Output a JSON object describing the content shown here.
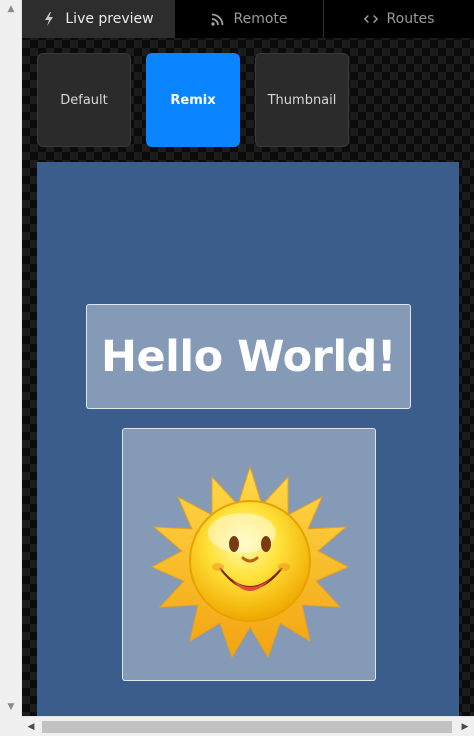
{
  "tabs": [
    {
      "label": "Live preview",
      "icon": "lightning-icon",
      "active": true
    },
    {
      "label": "Remote",
      "icon": "rss-icon",
      "active": false
    },
    {
      "label": "Routes",
      "icon": "code-brackets-icon",
      "active": false
    }
  ],
  "modes": [
    {
      "label": "Default",
      "active": false
    },
    {
      "label": "Remix",
      "active": true
    },
    {
      "label": "Thumbnail",
      "active": false
    }
  ],
  "preview": {
    "title": "Hello World!",
    "image": "smiling-sun-icon"
  },
  "colors": {
    "accent": "#0a84ff",
    "canvas_bg": "#3a5d8c",
    "tab_active_bg": "#2d2d2d"
  }
}
